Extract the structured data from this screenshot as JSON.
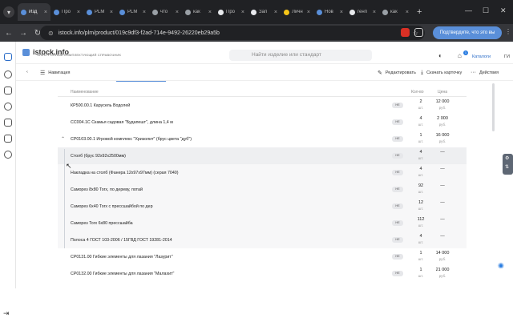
{
  "browser": {
    "tabs": [
      {
        "title": "Изд",
        "color": "#5a8fd9",
        "active": true
      },
      {
        "title": "Про",
        "color": "#5a8fd9"
      },
      {
        "title": "PLM",
        "color": "#5a8fd9"
      },
      {
        "title": "PLM",
        "color": "#5a8fd9"
      },
      {
        "title": "что",
        "color": "#9aa0a6"
      },
      {
        "title": "как",
        "color": "#9aa0a6"
      },
      {
        "title": "Про",
        "color": "#e8eaed"
      },
      {
        "title": "Зап",
        "color": "#e8eaed"
      },
      {
        "title": "Личн",
        "color": "#f5c518"
      },
      {
        "title": "Нов",
        "color": "#5a8fd9"
      },
      {
        "title": "генп",
        "color": "#e8eaed"
      },
      {
        "title": "как",
        "color": "#9aa0a6"
      }
    ],
    "new_tab": "+",
    "url": "istock.info/plm/product/019c9df3-f2ad-714e-9492-26220eb29a5b",
    "translate_label": "Подтвердите, что это вы"
  },
  "app": {
    "brand": "istock.info",
    "tagline": "ЭЛЕКТРОННЫЙ КОМПЛЕКТУЮЩИЙ СПРАВОЧНИК",
    "search_placeholder": "Найти изделие или стандарт",
    "notification_count": "1",
    "catalog_label": "Каталоги",
    "user_initials": "ГИ"
  },
  "toolbar": {
    "nav_label": "Навигация",
    "edit_label": "Редактировать",
    "download_label": "Скачать карточку",
    "actions_label": "Действия"
  },
  "table": {
    "headers": {
      "name": "Наименование",
      "qty": "Кол-во",
      "price": "Цена"
    },
    "rows": [
      {
        "name": "КР500.00.1 Карусель Водолей",
        "status": "НЕ",
        "qty": "2",
        "unit": "шт.",
        "price": "12 000",
        "currency": "руб."
      },
      {
        "name": "СС004.1С Скамья садовая \"Будапешт\", длина 1,4 м",
        "status": "НЕ",
        "qty": "4",
        "unit": "шт.",
        "price": "2 000",
        "currency": "руб."
      },
      {
        "name": "СР0103.00.1 Игровой комплекс \"Хризолит\" (брус цвета \"дуб\")",
        "status": "НЕ",
        "qty": "1",
        "unit": "шт.",
        "price": "16 000",
        "currency": "руб.",
        "expanded": true
      },
      {
        "name": "Столб (брус 92х92х2500мм)",
        "status": "НЕ",
        "qty": "4",
        "unit": "шт.",
        "price": "—",
        "currency": "",
        "sub": true
      },
      {
        "name": "Накладка на столб (Фанера 12х97х97мм) (серая 7040)",
        "status": "НЕ",
        "qty": "4",
        "unit": "шт.",
        "price": "—",
        "currency": "",
        "sub": true
      },
      {
        "name": "Саморез 8х80 Torx, по дереву, потай",
        "status": "НЕ",
        "qty": "92",
        "unit": "шт.",
        "price": "—",
        "currency": "",
        "sub": true
      },
      {
        "name": "Саморез 6х40 Torx с прессшайбой по дер",
        "status": "НЕ",
        "qty": "12",
        "unit": "шт.",
        "price": "—",
        "currency": "",
        "sub": true
      },
      {
        "name": "Саморез Torx 6х80 прессшайба",
        "status": "НЕ",
        "qty": "112",
        "unit": "шт.",
        "price": "—",
        "currency": "",
        "sub": true
      },
      {
        "name": "Полоса 4 ГОСТ 103-2006 / 15ГВД ГОСТ 19281-2014",
        "status": "НЕ",
        "qty": "4",
        "unit": "шт.",
        "price": "—",
        "currency": "",
        "sub": true
      },
      {
        "name": "СР0131.00 Гибкие элементы для лазания \"Лазурит\"",
        "status": "НЕ",
        "qty": "1",
        "unit": "шт.",
        "price": "14 000",
        "currency": "руб."
      },
      {
        "name": "СР0132.00 Гибкие элементы для лазания \"Малахит\"",
        "status": "НЕ",
        "qty": "1",
        "unit": "шт.",
        "price": "21 000",
        "currency": "руб."
      }
    ]
  }
}
